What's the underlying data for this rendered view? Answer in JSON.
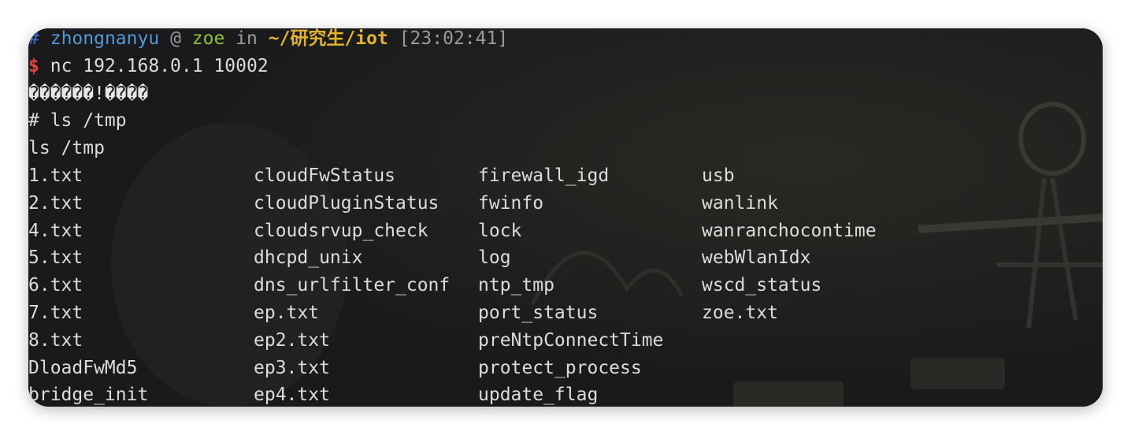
{
  "prompt": {
    "hash": "#",
    "user": "zhongnanyu",
    "at": "@",
    "host": "zoe",
    "in": "in",
    "path": "~/研究生/iot",
    "time": "[23:02:41]"
  },
  "command": {
    "dollar": "$",
    "text": "nc 192.168.0.1 10002"
  },
  "output": {
    "garbled": "������!����",
    "shell_cmd": "# ls /tmp",
    "echo": "ls /tmp",
    "rows": [
      [
        "1.txt",
        "cloudFwStatus",
        "firewall_igd",
        "usb"
      ],
      [
        "2.txt",
        "cloudPluginStatus",
        "fwinfo",
        "wanlink"
      ],
      [
        "4.txt",
        "cloudsrvup_check",
        "lock",
        "wanranchocontime"
      ],
      [
        "5.txt",
        "dhcpd_unix",
        "log",
        "webWlanIdx"
      ],
      [
        "6.txt",
        "dns_urlfilter_conf",
        "ntp_tmp",
        "wscd_status"
      ],
      [
        "7.txt",
        "ep.txt",
        "port_status",
        "zoe.txt"
      ],
      [
        "8.txt",
        "ep2.txt",
        "preNtpConnectTime",
        ""
      ],
      [
        "DloadFwMd5",
        "ep3.txt",
        "protect_process",
        ""
      ],
      [
        "bridge_init",
        "ep4.txt",
        "update_flag",
        ""
      ]
    ]
  },
  "colors": {
    "background": "#1b1b1d",
    "text": "#dcdcdc",
    "user": "#4f9ad6",
    "host": "#8fbf3a",
    "path": "#e3b32a",
    "dollar": "#e0473a"
  }
}
